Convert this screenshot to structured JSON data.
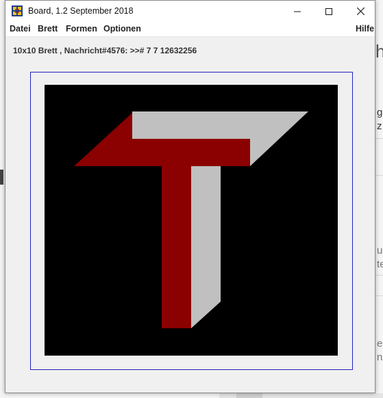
{
  "window": {
    "title": "Board, 1.2 September 2018"
  },
  "menu": {
    "datei": "Datei",
    "brett": "Brett",
    "formen": "Formen",
    "optionen": "Optionen",
    "hilfe": "Hilfe"
  },
  "status": {
    "text": "10x10 Brett , Nachricht#4576: >>#  7 7 12632256"
  },
  "board": {
    "background_color": "#000000",
    "front_color": "#8b0000",
    "side_color": "#c0c0c0",
    "frame_color": "#2020c0",
    "shape": "T"
  },
  "background": {
    "frag_1": "h",
    "frag_2": "g",
    "frag_3": "z",
    "frag_4": "u",
    "frag_5": "te",
    "frag_6": "e",
    "frag_7": "n"
  }
}
